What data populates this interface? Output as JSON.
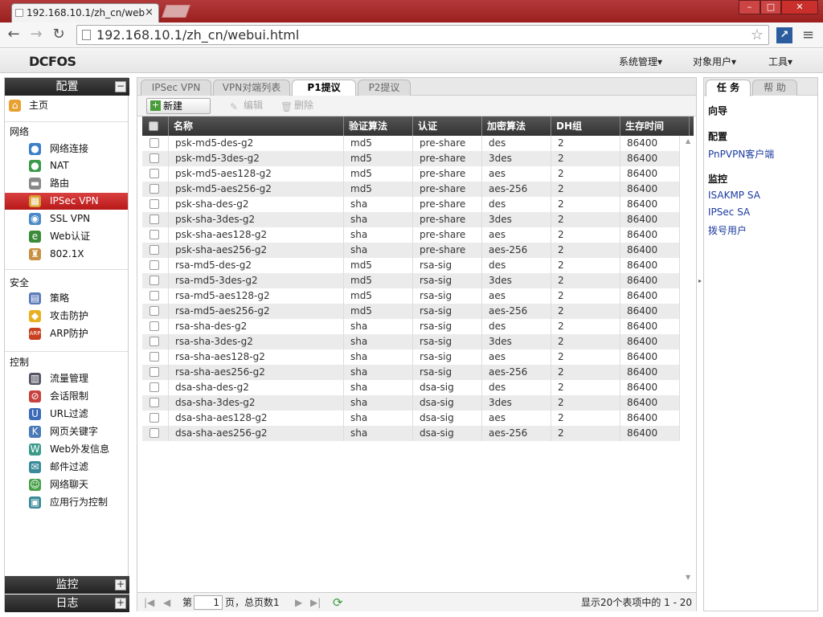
{
  "browser": {
    "tab_title": "192.168.10.1/zh_cn/web",
    "tab_close": "×",
    "url": "192.168.10.1/zh_cn/webui.html",
    "window_buttons": {
      "minimize": "–",
      "maximize": "□",
      "close": "✕"
    }
  },
  "app": {
    "logo": "DCFOS",
    "header_menu": [
      "系统管理▾",
      "对象用户▾",
      "工具▾"
    ]
  },
  "sidebar": {
    "config_title": "配置",
    "home": "主页",
    "sections": {
      "network": "网络",
      "security": "安全",
      "control": "控制"
    },
    "network_items": [
      "网络连接",
      "NAT",
      "路由",
      "IPSec VPN",
      "SSL VPN",
      "Web认证",
      "802.1X"
    ],
    "security_items": [
      "策略",
      "攻击防护",
      "ARP防护"
    ],
    "control_items": [
      "流量管理",
      "会话限制",
      "URL过滤",
      "网页关键字",
      "Web外发信息",
      "邮件过滤",
      "网络聊天",
      "应用行为控制"
    ],
    "monitor_title": "监控",
    "log_title": "日志",
    "active_item": "IPSec VPN"
  },
  "tabs": [
    "IPSec VPN",
    "VPN对端列表",
    "P1提议",
    "P2提议"
  ],
  "active_tab": "P1提议",
  "actions": {
    "new": "新建",
    "edit": "编辑",
    "delete": "删除"
  },
  "table": {
    "headers": [
      "名称",
      "验证算法",
      "认证",
      "加密算法",
      "DH组",
      "生存时间"
    ],
    "rows": [
      [
        "psk-md5-des-g2",
        "md5",
        "pre-share",
        "des",
        "2",
        "86400"
      ],
      [
        "psk-md5-3des-g2",
        "md5",
        "pre-share",
        "3des",
        "2",
        "86400"
      ],
      [
        "psk-md5-aes128-g2",
        "md5",
        "pre-share",
        "aes",
        "2",
        "86400"
      ],
      [
        "psk-md5-aes256-g2",
        "md5",
        "pre-share",
        "aes-256",
        "2",
        "86400"
      ],
      [
        "psk-sha-des-g2",
        "sha",
        "pre-share",
        "des",
        "2",
        "86400"
      ],
      [
        "psk-sha-3des-g2",
        "sha",
        "pre-share",
        "3des",
        "2",
        "86400"
      ],
      [
        "psk-sha-aes128-g2",
        "sha",
        "pre-share",
        "aes",
        "2",
        "86400"
      ],
      [
        "psk-sha-aes256-g2",
        "sha",
        "pre-share",
        "aes-256",
        "2",
        "86400"
      ],
      [
        "rsa-md5-des-g2",
        "md5",
        "rsa-sig",
        "des",
        "2",
        "86400"
      ],
      [
        "rsa-md5-3des-g2",
        "md5",
        "rsa-sig",
        "3des",
        "2",
        "86400"
      ],
      [
        "rsa-md5-aes128-g2",
        "md5",
        "rsa-sig",
        "aes",
        "2",
        "86400"
      ],
      [
        "rsa-md5-aes256-g2",
        "md5",
        "rsa-sig",
        "aes-256",
        "2",
        "86400"
      ],
      [
        "rsa-sha-des-g2",
        "sha",
        "rsa-sig",
        "des",
        "2",
        "86400"
      ],
      [
        "rsa-sha-3des-g2",
        "sha",
        "rsa-sig",
        "3des",
        "2",
        "86400"
      ],
      [
        "rsa-sha-aes128-g2",
        "sha",
        "rsa-sig",
        "aes",
        "2",
        "86400"
      ],
      [
        "rsa-sha-aes256-g2",
        "sha",
        "rsa-sig",
        "aes-256",
        "2",
        "86400"
      ],
      [
        "dsa-sha-des-g2",
        "sha",
        "dsa-sig",
        "des",
        "2",
        "86400"
      ],
      [
        "dsa-sha-3des-g2",
        "sha",
        "dsa-sig",
        "3des",
        "2",
        "86400"
      ],
      [
        "dsa-sha-aes128-g2",
        "sha",
        "dsa-sig",
        "aes",
        "2",
        "86400"
      ],
      [
        "dsa-sha-aes256-g2",
        "sha",
        "dsa-sig",
        "aes-256",
        "2",
        "86400"
      ]
    ]
  },
  "pager": {
    "page_prefix": "第",
    "page_value": "1",
    "page_suffix": "页，总页数1",
    "info": "显示20个表项中的 1 - 20"
  },
  "right_panel": {
    "tabs": [
      "任 务",
      "帮 助"
    ],
    "wizard": "向导",
    "config_heading": "配置",
    "config_links": [
      "PnPVPN客户端"
    ],
    "monitor_heading": "监控",
    "monitor_links": [
      "ISAKMP SA",
      "IPSec SA",
      "拨号用户"
    ]
  },
  "colors": {
    "titlebar": "#9b1f1f",
    "active_item": "#c42020",
    "table_header": "#444444",
    "link": "#1a3a9e"
  }
}
